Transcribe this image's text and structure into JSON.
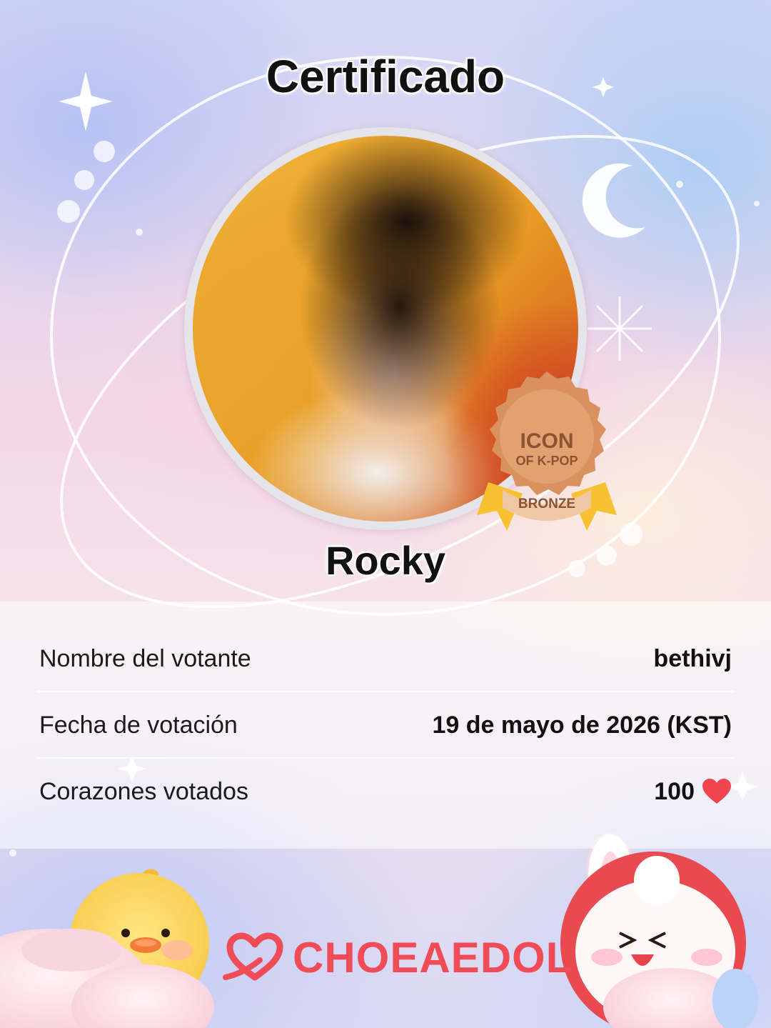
{
  "certificate": {
    "title": "Certificado",
    "idol_name": "Rocky",
    "badge": {
      "line1": "ICON",
      "line2": "OF K-POP",
      "tier": "BRONZE"
    }
  },
  "details": {
    "voter_label": "Nombre del votante",
    "voter_value": "bethivj",
    "date_label": "Fecha de votación",
    "date_value": "19 de mayo de 2026 (KST)",
    "hearts_label": "Corazones votados",
    "hearts_value": "100"
  },
  "brand": {
    "name": "CHOEAEDOL",
    "color": "#ef4c58"
  },
  "icons": {
    "heart": "heart-icon",
    "logo": "choeaedol-logo-icon",
    "moon": "moon-icon",
    "sparkle": "sparkle-icon",
    "chick": "chick-mascot",
    "bunny": "bunny-mascot"
  }
}
